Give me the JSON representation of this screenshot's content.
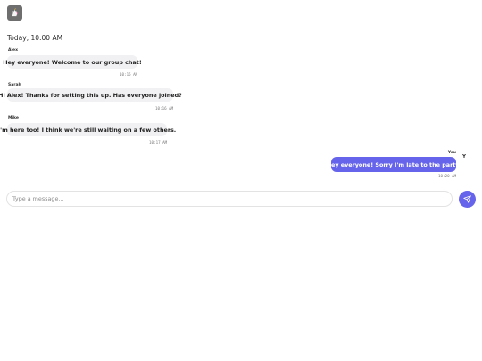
{
  "header": {
    "app_icon": "unicorn-icon",
    "date_label": "Today, 10:00 AM"
  },
  "messages": [
    {
      "sender": "Alex",
      "text": "Hey everyone! Welcome to our group chat!",
      "time": "10:15 AM"
    },
    {
      "sender": "Sarah",
      "text": "Hi Alex! Thanks for setting this up. Has everyone joined?",
      "time": "10:16 AM"
    },
    {
      "sender": "Mike",
      "text": "I'm here too! I think we're still waiting on a few others.",
      "time": "10:17 AM"
    },
    {
      "sender": "You",
      "text": "Hey everyone! Sorry I'm late to the party.",
      "time": "10:20 AM",
      "avatar_initial": "Y"
    }
  ],
  "composer": {
    "placeholder": "Type a message...",
    "send_icon": "send-icon"
  },
  "colors": {
    "accent": "#6664EA",
    "incoming_bubble": "#F1F1F3"
  }
}
